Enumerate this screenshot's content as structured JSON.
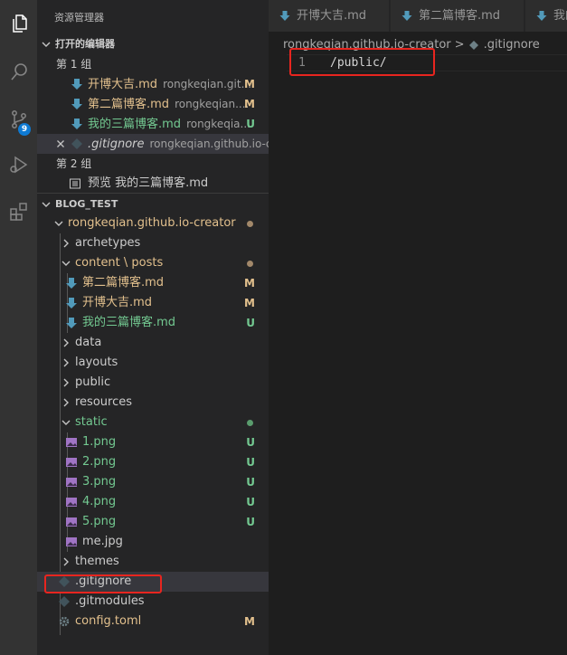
{
  "colors": {
    "modified": "#e2c08d",
    "untracked": "#73c991",
    "badge": "#0e7ad3",
    "annotation": "#e8251f"
  },
  "activity_bar": {
    "icons": [
      "files-icon",
      "search-icon",
      "source-control-icon",
      "run-debug-icon",
      "extensions-icon"
    ],
    "scm_badge": "9"
  },
  "sidebar": {
    "title": "资源管理器",
    "open_editors": {
      "header": "打开的编辑器",
      "group1": "第 1 组",
      "group2": "第 2 组",
      "items": [
        {
          "name": "开博大吉.md",
          "desc": "rongkeqian.git...",
          "status": "M"
        },
        {
          "name": "第二篇博客.md",
          "desc": "rongkeqian....",
          "status": "M"
        },
        {
          "name": "我的三篇博客.md",
          "desc": "rongkeqia...",
          "status": "U"
        },
        {
          "name": ".gitignore",
          "desc": "rongkeqian.github.io-cre...",
          "status": ""
        }
      ],
      "preview_item": "预览 我的三篇博客.md"
    },
    "workspace": {
      "header": "BLOG_TEST",
      "root": "rongkeqian.github.io-creator",
      "archetypes": "archetypes",
      "content_posts": "content \\ posts",
      "posts": [
        {
          "name": "第二篇博客.md",
          "status": "M"
        },
        {
          "name": "开博大吉.md",
          "status": "M"
        },
        {
          "name": "我的三篇博客.md",
          "status": "U"
        }
      ],
      "folders": [
        "data",
        "layouts",
        "public",
        "resources"
      ],
      "static": "static",
      "static_files": [
        {
          "name": "1.png",
          "status": "U"
        },
        {
          "name": "2.png",
          "status": "U"
        },
        {
          "name": "3.png",
          "status": "U"
        },
        {
          "name": "4.png",
          "status": "U"
        },
        {
          "name": "5.png",
          "status": "U"
        },
        {
          "name": "me.jpg",
          "status": ""
        }
      ],
      "themes": "themes",
      "gitignore": ".gitignore",
      "gitmodules": ".gitmodules",
      "config": "config.toml",
      "config_status": "M"
    }
  },
  "editor": {
    "tabs": [
      "开博大吉.md",
      "第二篇博客.md",
      "我的"
    ],
    "breadcrumb": {
      "folder": "rongkeqian.github.io-creator",
      "separator": ">",
      "file": ".gitignore"
    },
    "lines": [
      {
        "number": "1",
        "text": "/public/"
      }
    ]
  }
}
